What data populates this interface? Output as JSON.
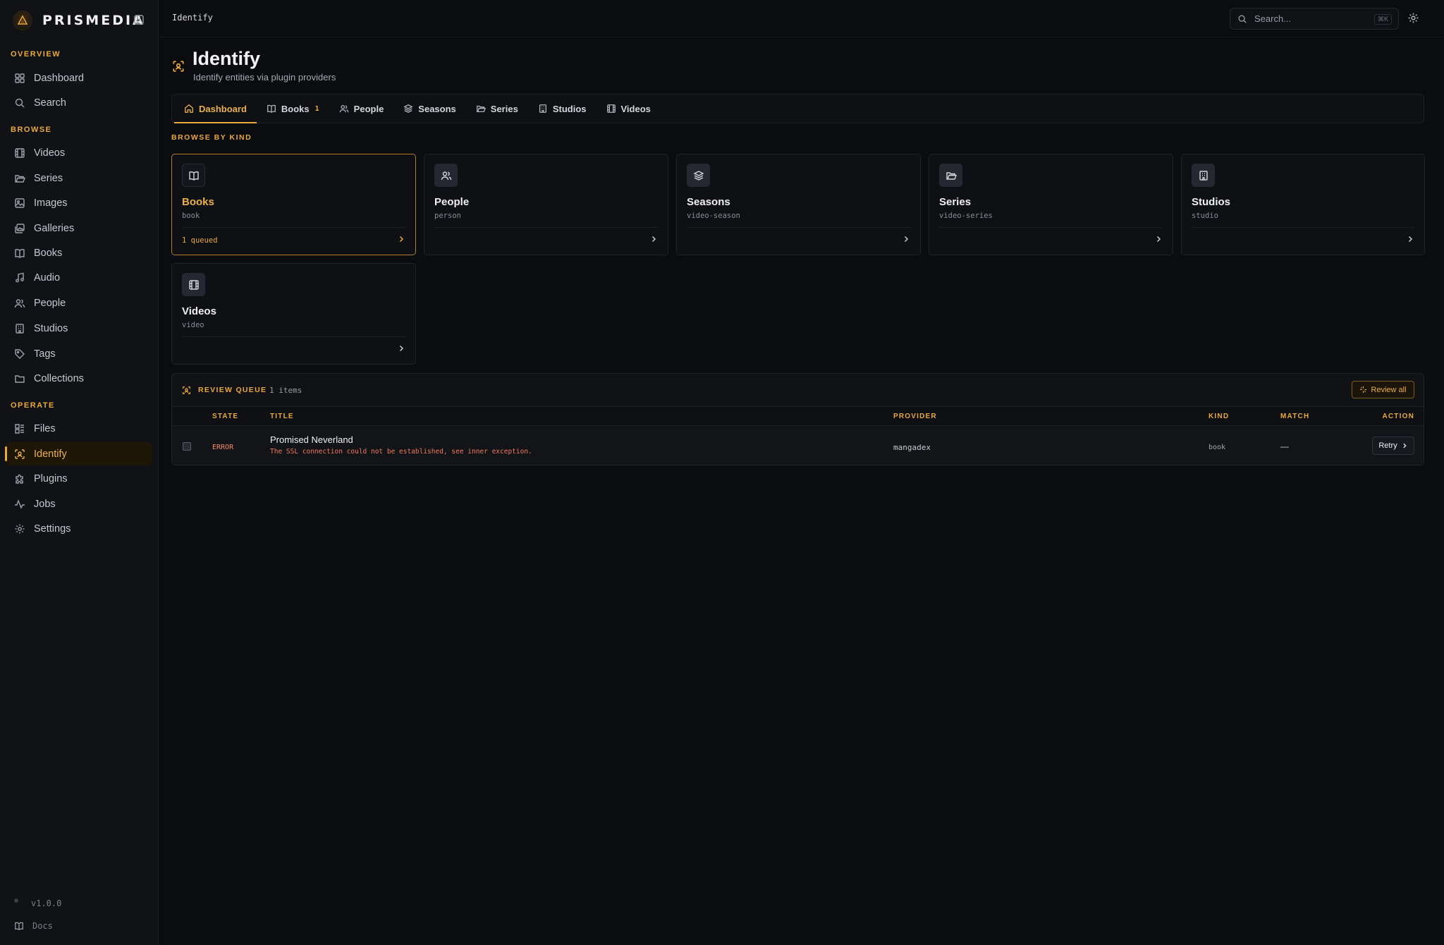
{
  "sidebar": {
    "brand": "PRISMEDIA",
    "sections": {
      "overview": "OVERVIEW",
      "browse": "BROWSE",
      "operate": "OPERATE"
    },
    "items": {
      "dashboard": "Dashboard",
      "search": "Search",
      "videos": "Videos",
      "series": "Series",
      "images": "Images",
      "galleries": "Galleries",
      "books": "Books",
      "audio": "Audio",
      "people": "People",
      "studios": "Studios",
      "tags": "Tags",
      "collections": "Collections",
      "files": "Files",
      "identify": "Identify",
      "plugins": "Plugins",
      "jobs": "Jobs",
      "settings": "Settings"
    },
    "version": "v1.0.0",
    "docs": "Docs"
  },
  "topbar": {
    "breadcrumb": "Identify",
    "search_placeholder": "Search...",
    "search_shortcut": "⌘K"
  },
  "header": {
    "title": "Identify",
    "subtitle": "Identify entities via plugin providers"
  },
  "tabs": {
    "dashboard": "Dashboard",
    "books": "Books",
    "books_badge": "1",
    "people": "People",
    "seasons": "Seasons",
    "series": "Series",
    "studios": "Studios",
    "videos": "Videos"
  },
  "browse": {
    "label": "BROWSE BY KIND",
    "cards": [
      {
        "title": "Books",
        "kind": "book",
        "status": "1 queued",
        "icon": "book-open-icon"
      },
      {
        "title": "People",
        "kind": "person",
        "status": "",
        "icon": "users-icon"
      },
      {
        "title": "Seasons",
        "kind": "video-season",
        "status": "",
        "icon": "layers-icon"
      },
      {
        "title": "Series",
        "kind": "video-series",
        "status": "",
        "icon": "folder-open-icon"
      },
      {
        "title": "Studios",
        "kind": "studio",
        "status": "",
        "icon": "building-icon"
      },
      {
        "title": "Videos",
        "kind": "video",
        "status": "",
        "icon": "film-icon"
      }
    ]
  },
  "queue": {
    "title": "REVIEW QUEUE",
    "count": "1 items",
    "review_all": "Review all",
    "columns": {
      "state": "STATE",
      "title": "TITLE",
      "provider": "PROVIDER",
      "kind": "KIND",
      "match": "MATCH",
      "action": "ACTION"
    },
    "rows": [
      {
        "state": "ERROR",
        "title": "Promised Neverland",
        "error": "The SSL connection could not be established, see inner exception.",
        "provider": "mangadex",
        "kind": "book",
        "match": "—",
        "action": "Retry"
      }
    ]
  },
  "colors": {
    "accent": "#e9a93c",
    "background": "#0b0c10",
    "sidebar": "#101216",
    "error": "#f07a5e"
  }
}
